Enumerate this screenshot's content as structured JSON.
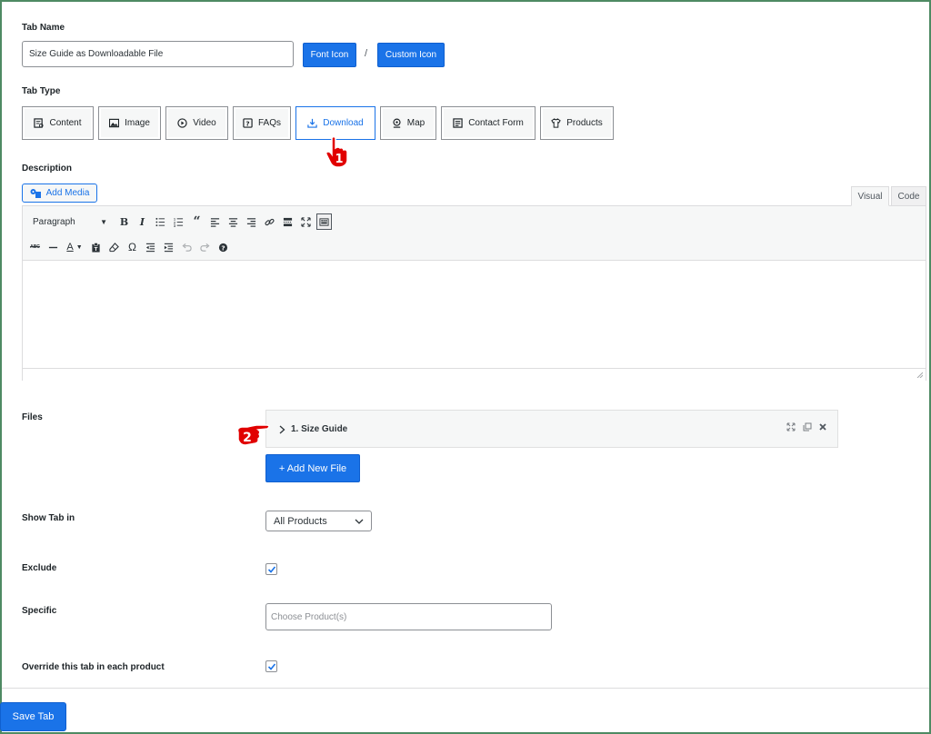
{
  "tab_name": {
    "label": "Tab Name",
    "value": "Size Guide as Downloadable File",
    "font_icon_label": "Font Icon",
    "separator": "/",
    "custom_icon_label": "Custom Icon"
  },
  "tab_type": {
    "label": "Tab Type",
    "options": [
      {
        "label": "Content",
        "icon": "content-icon"
      },
      {
        "label": "Image",
        "icon": "image-icon"
      },
      {
        "label": "Video",
        "icon": "play-icon"
      },
      {
        "label": "FAQs",
        "icon": "faq-icon"
      },
      {
        "label": "Download",
        "icon": "download-icon",
        "active": true
      },
      {
        "label": "Map",
        "icon": "map-pin-icon"
      },
      {
        "label": "Contact Form",
        "icon": "form-icon"
      },
      {
        "label": "Products",
        "icon": "shirt-icon"
      }
    ]
  },
  "description": {
    "label": "Description",
    "add_media_label": "Add Media",
    "tabs": [
      "Visual",
      "Code"
    ],
    "format_select": "Paragraph",
    "toolbar_row1": [
      "bold-icon",
      "italic-icon",
      "bullet-list-icon",
      "numbered-list-icon",
      "blockquote-icon",
      "align-left-icon",
      "align-center-icon",
      "align-right-icon",
      "link-icon",
      "read-more-icon",
      "fullscreen-icon",
      "toolbar-toggle-icon"
    ],
    "toolbar_row2": [
      "strikethrough-icon",
      "horizontal-line-icon",
      "text-color-icon",
      "paste-text-icon",
      "clear-formatting-icon",
      "special-character-icon",
      "outdent-icon",
      "indent-icon",
      "undo-icon",
      "redo-icon",
      "help-icon"
    ]
  },
  "files": {
    "label": "Files",
    "items": [
      "1. Size Guide"
    ],
    "add_label": "+ Add New File"
  },
  "show_tab_in": {
    "label": "Show Tab in",
    "selected": "All Products"
  },
  "exclude": {
    "label": "Exclude",
    "checked": true
  },
  "specific": {
    "label": "Specific",
    "placeholder": "Choose Product(s)"
  },
  "override": {
    "label": "Override this tab in each product",
    "checked": true
  },
  "save_label": "Save Tab",
  "markers": [
    "1",
    "2"
  ],
  "colors": {
    "accent": "#1a73e8",
    "marker": "#e10000"
  }
}
